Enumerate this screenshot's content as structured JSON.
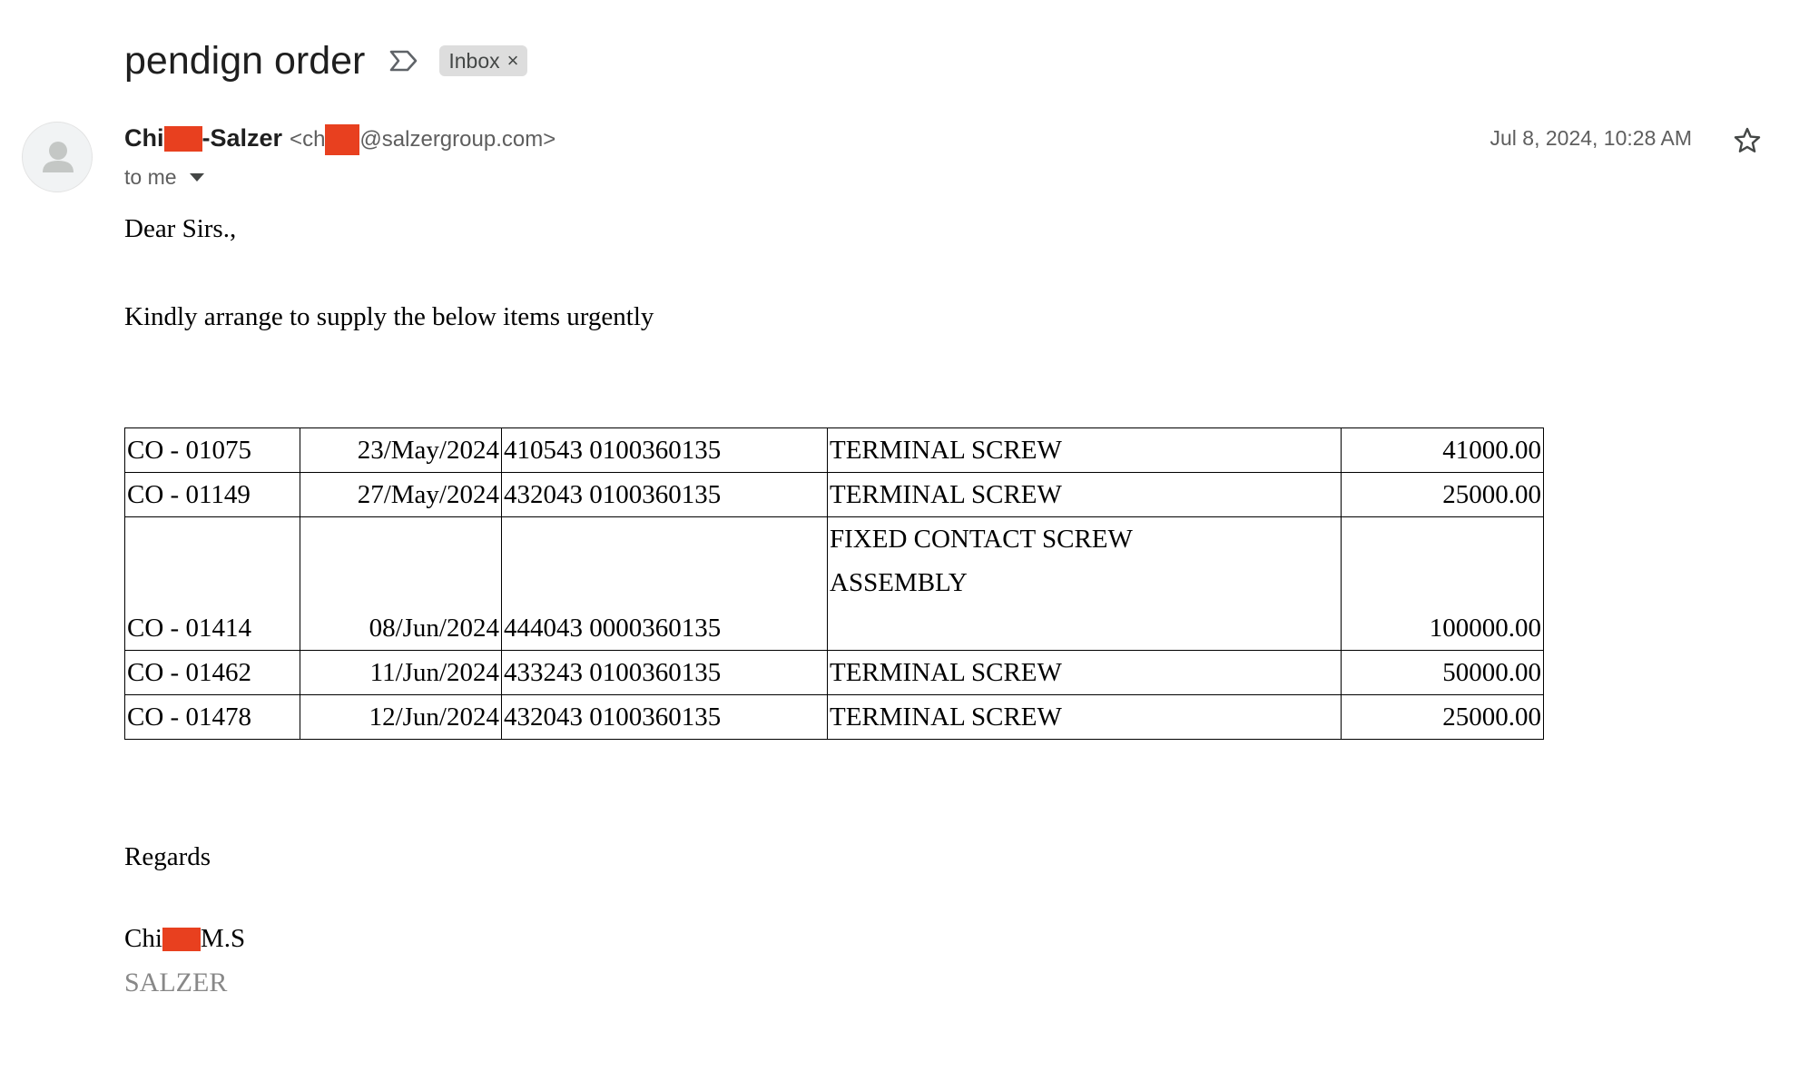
{
  "subject": "pendign order",
  "label": {
    "name": "Inbox",
    "remove_symbol": "×"
  },
  "sender": {
    "name_prefix": "Chi",
    "name_suffix": "-Salzer",
    "email_prefix": "<ch",
    "email_suffix": "@salzergroup.com>",
    "redaction_color": "#e8401f"
  },
  "recipient": "to me",
  "date": "Jul 8, 2024, 10:28 AM",
  "message": {
    "greeting": "Dear Sirs.,",
    "intro": "Kindly arrange to supply the below items urgently",
    "rows": [
      {
        "order": "CO - 01075",
        "date": "23/May/2024",
        "part": "410543 0100360135",
        "desc1": "TERMINAL SCREW",
        "desc2": "",
        "qty": "41000.00"
      },
      {
        "order": "CO - 01149",
        "date": "27/May/2024",
        "part": "432043 0100360135",
        "desc1": "TERMINAL SCREW",
        "desc2": "",
        "qty": "25000.00"
      },
      {
        "order": "CO - 01414",
        "date": "08/Jun/2024",
        "part": "444043 0000360135",
        "desc1": "FIXED CONTACT SCREW",
        "desc2": "ASSEMBLY",
        "qty": "100000.00"
      },
      {
        "order": "CO - 01462",
        "date": "11/Jun/2024",
        "part": "433243 0100360135",
        "desc1": "TERMINAL SCREW",
        "desc2": "",
        "qty": "50000.00"
      },
      {
        "order": "CO - 01478",
        "date": "12/Jun/2024",
        "part": "432043 0100360135",
        "desc1": "TERMINAL SCREW",
        "desc2": "",
        "qty": "25000.00"
      }
    ],
    "closing": "Regards",
    "signature_prefix": "Chi",
    "signature_suffix": "M.S",
    "company": "SALZER"
  },
  "icons": {
    "important": "label-important-icon",
    "star": "star-icon",
    "avatar": "person-avatar-icon",
    "caret": "caret-down-icon"
  }
}
